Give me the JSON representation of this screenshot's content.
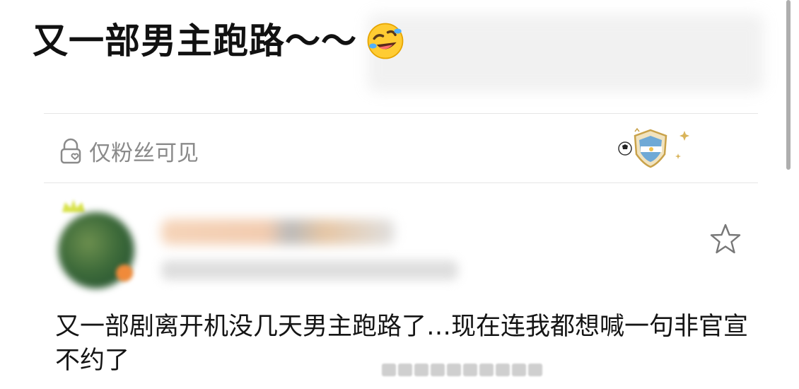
{
  "post": {
    "title": "又一部男主跑路～～",
    "title_emoji": "rolling-on-floor-laughing-emoji"
  },
  "visibility": {
    "icon": "lock-heart-icon",
    "label": "仅粉丝可见"
  },
  "badge": {
    "icon": "argentina-football-shield-badge"
  },
  "comment": {
    "text": "又一部剧离开机没几天男主跑路了…现在连我都想喊一句非官宣不约了",
    "favorite_icon": "star-outline-icon"
  },
  "colors": {
    "muted_text": "#8a8a8a",
    "divider": "#e6e6e6",
    "badge_blue": "#6fa9d6",
    "badge_gold": "#c9a24a"
  }
}
